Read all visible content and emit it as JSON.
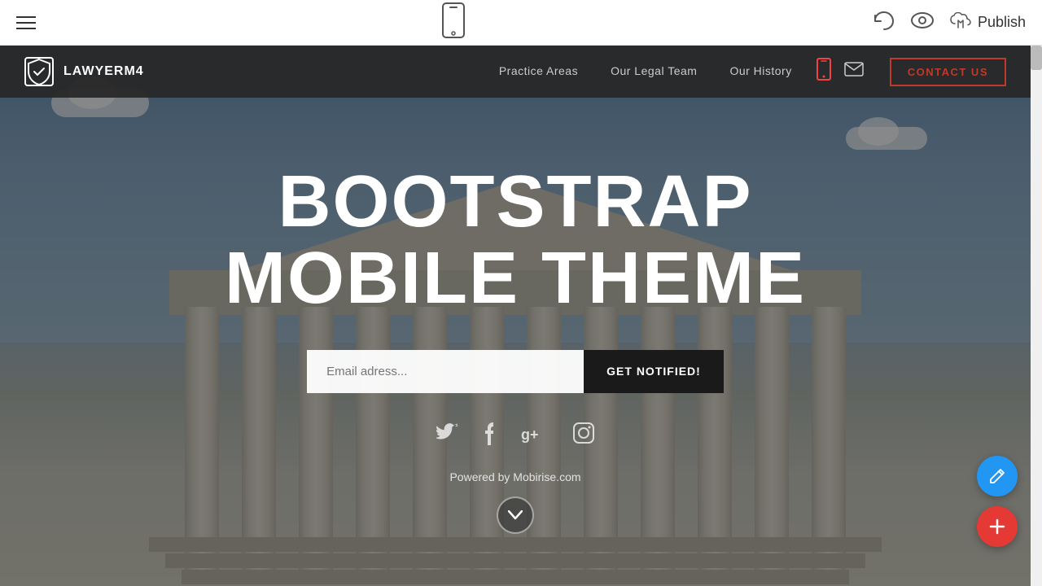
{
  "editor": {
    "publish_label": "Publish"
  },
  "navbar": {
    "brand_name": "LAWYERM4",
    "nav_items": [
      {
        "label": "Practice Areas"
      },
      {
        "label": "Our Legal Team"
      },
      {
        "label": "Our History"
      }
    ],
    "contact_label": "CONTACT US"
  },
  "hero": {
    "title_line1": "BOOTSTRAP",
    "title_line2": "MOBILE THEME",
    "email_placeholder": "Email adress...",
    "cta_button": "GET NOTIFIED!",
    "powered_by": "Powered by Mobirise.com",
    "social_icons": [
      {
        "name": "twitter",
        "symbol": "🐦"
      },
      {
        "name": "facebook",
        "symbol": "f"
      },
      {
        "name": "google-plus",
        "symbol": "g+"
      },
      {
        "name": "instagram",
        "symbol": "📷"
      }
    ]
  }
}
